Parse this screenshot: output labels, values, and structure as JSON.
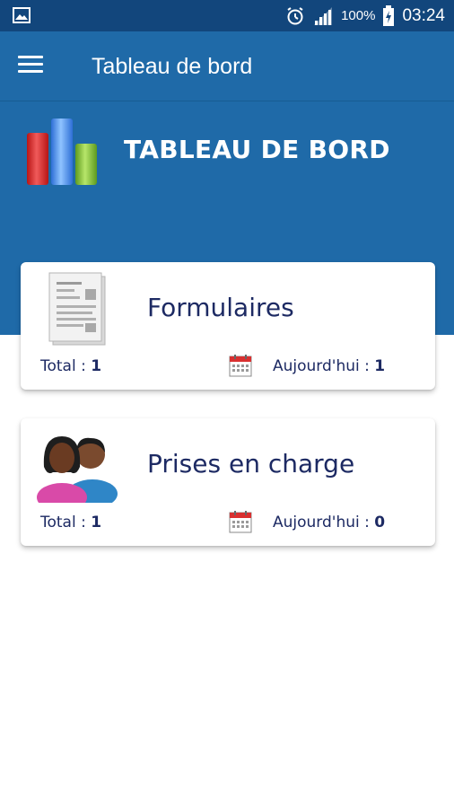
{
  "status_bar": {
    "battery": "100%",
    "time": "03:24",
    "icons": [
      "gallery-icon",
      "alarm-icon",
      "signal-icon",
      "battery-charging-icon"
    ]
  },
  "app_bar": {
    "title": "Tableau de bord",
    "menu_icon": "hamburger-menu-icon"
  },
  "header": {
    "title": "TABLEAU DE BORD",
    "logo_icon": "bar-chart-icon"
  },
  "cards": [
    {
      "title": "Formulaires",
      "icon": "document-icon",
      "total_label": "Total  : ",
      "total_value": "1",
      "today_label": "Aujourd'hui : ",
      "today_value": "1"
    },
    {
      "title": "Prises en charge",
      "icon": "people-icon",
      "total_label": "Total  : ",
      "total_value": "1",
      "today_label": "Aujourd'hui : ",
      "today_value": "0"
    }
  ],
  "colors": {
    "status_bar": "#12467c",
    "primary": "#1f6aa8",
    "text_dark": "#1d2a63"
  }
}
